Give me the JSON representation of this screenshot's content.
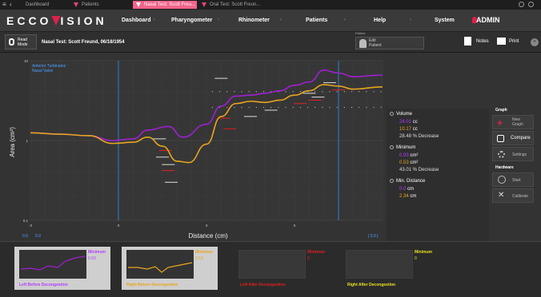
{
  "tabs": [
    {
      "label": "Dashboard"
    },
    {
      "label": "Patients"
    },
    {
      "label": "Nasal Test: Scott Freu..."
    },
    {
      "label": "Oral Test: Scott Freun..."
    }
  ],
  "logo": {
    "text_left": "ECCO",
    "text_right": "ISION"
  },
  "nav": [
    "Dashboard",
    "Pharyngometer",
    "Rhinometer",
    "Patients",
    "Help",
    "System"
  ],
  "admin": "ADMIN",
  "subbar": {
    "read_mode": "Read\nMode",
    "title": "Nasal Test: Scott Freund, 06/18/1954",
    "patient_label": "Patient",
    "edit_patient": "Edit\nPatient",
    "notes": "Notes",
    "print": "Print"
  },
  "chart_overlay": {
    "line1": "Anterior Turbinates",
    "line2": "Nasal Valve"
  },
  "chart_data": {
    "type": "line",
    "xlabel": "Distance (cm)",
    "ylabel": "Area (cm²)",
    "yscale": "log",
    "xlim": [
      -3,
      9
    ],
    "ylim": [
      0.1,
      10
    ],
    "xticks": [
      "-3",
      "0",
      "3",
      "6"
    ],
    "yticks": [
      "10",
      "1",
      "0.1"
    ],
    "series": [
      {
        "name": "Left Before Decongestion",
        "color": "#a020d0",
        "x": [
          -3,
          -2,
          -1,
          -0.2,
          0.5,
          1,
          1.7,
          2.2,
          3,
          3.5,
          4,
          4.5,
          5,
          5.5,
          6,
          6.5,
          7,
          7.5,
          8,
          9
        ],
        "y": [
          1.25,
          1.2,
          1.15,
          1.0,
          1.05,
          1.35,
          1.5,
          1.1,
          1.6,
          2.7,
          3.6,
          3.7,
          3.9,
          4.2,
          4.9,
          5.4,
          7.6,
          7.0,
          6.3,
          6.6
        ]
      },
      {
        "name": "Right Before Decongestion",
        "color": "#e7a520",
        "x": [
          -3,
          -2,
          -1,
          -0.2,
          0.5,
          1,
          1.5,
          2,
          2.4,
          3,
          3.5,
          4,
          4.5,
          5,
          5.5,
          6,
          6.5,
          7,
          7.5,
          8,
          9
        ],
        "y": [
          1.25,
          1.2,
          1.15,
          0.92,
          0.95,
          1.1,
          0.85,
          0.55,
          0.53,
          0.9,
          2.0,
          2.9,
          3.1,
          3.0,
          3.2,
          3.7,
          4.2,
          5.0,
          4.8,
          4.4,
          4.7
        ]
      }
    ]
  },
  "bottom_scale": {
    "left_a": "0.0",
    "left_b": "0.0",
    "right": "[ 0.0 ]"
  },
  "legend": {
    "volume_label": "Volume",
    "volume_left": "24.01",
    "volume_right": "10.17",
    "volume_unit": "cc",
    "volume_decrease": "28.48 % Decrease",
    "minimum_label": "Minimum",
    "minimum_left": "0.93",
    "minimum_right": "0.53",
    "minimum_unit": "cm²",
    "minimum_decrease": "43.01 % Decrease",
    "mindist_label": "Min. Distance",
    "mindist_left": "0.0",
    "mindist_right": "2.34",
    "mindist_unit": "cm"
  },
  "graph_panel": {
    "title": "Graph",
    "new_graph": "New\nGraph",
    "compare": "Compare",
    "settings": "Settings",
    "hardware_title": "Hardware",
    "start": "Start",
    "calibrate": "Calibrate"
  },
  "thumbs": [
    {
      "label": "Left Before Decongestion",
      "label_color": "#b33cff",
      "min_label": "Minimum",
      "min_value": "0.93",
      "min_color": "#b33cff",
      "active": true
    },
    {
      "label": "Right Before Decongestion",
      "label_color": "#e7a520",
      "min_label": "Minimum",
      "min_value": "0.53",
      "min_color": "#e7a520",
      "active": true
    },
    {
      "label": "Left After Decongestion",
      "label_color": "#e02020",
      "min_label": "Minimum",
      "min_value": "0",
      "min_color": "#e02020",
      "active": false
    },
    {
      "label": "Right After Decongestion",
      "label_color": "#e8e020",
      "min_label": "Minimum",
      "min_value": "0",
      "min_color": "#e8e020",
      "active": false
    }
  ]
}
